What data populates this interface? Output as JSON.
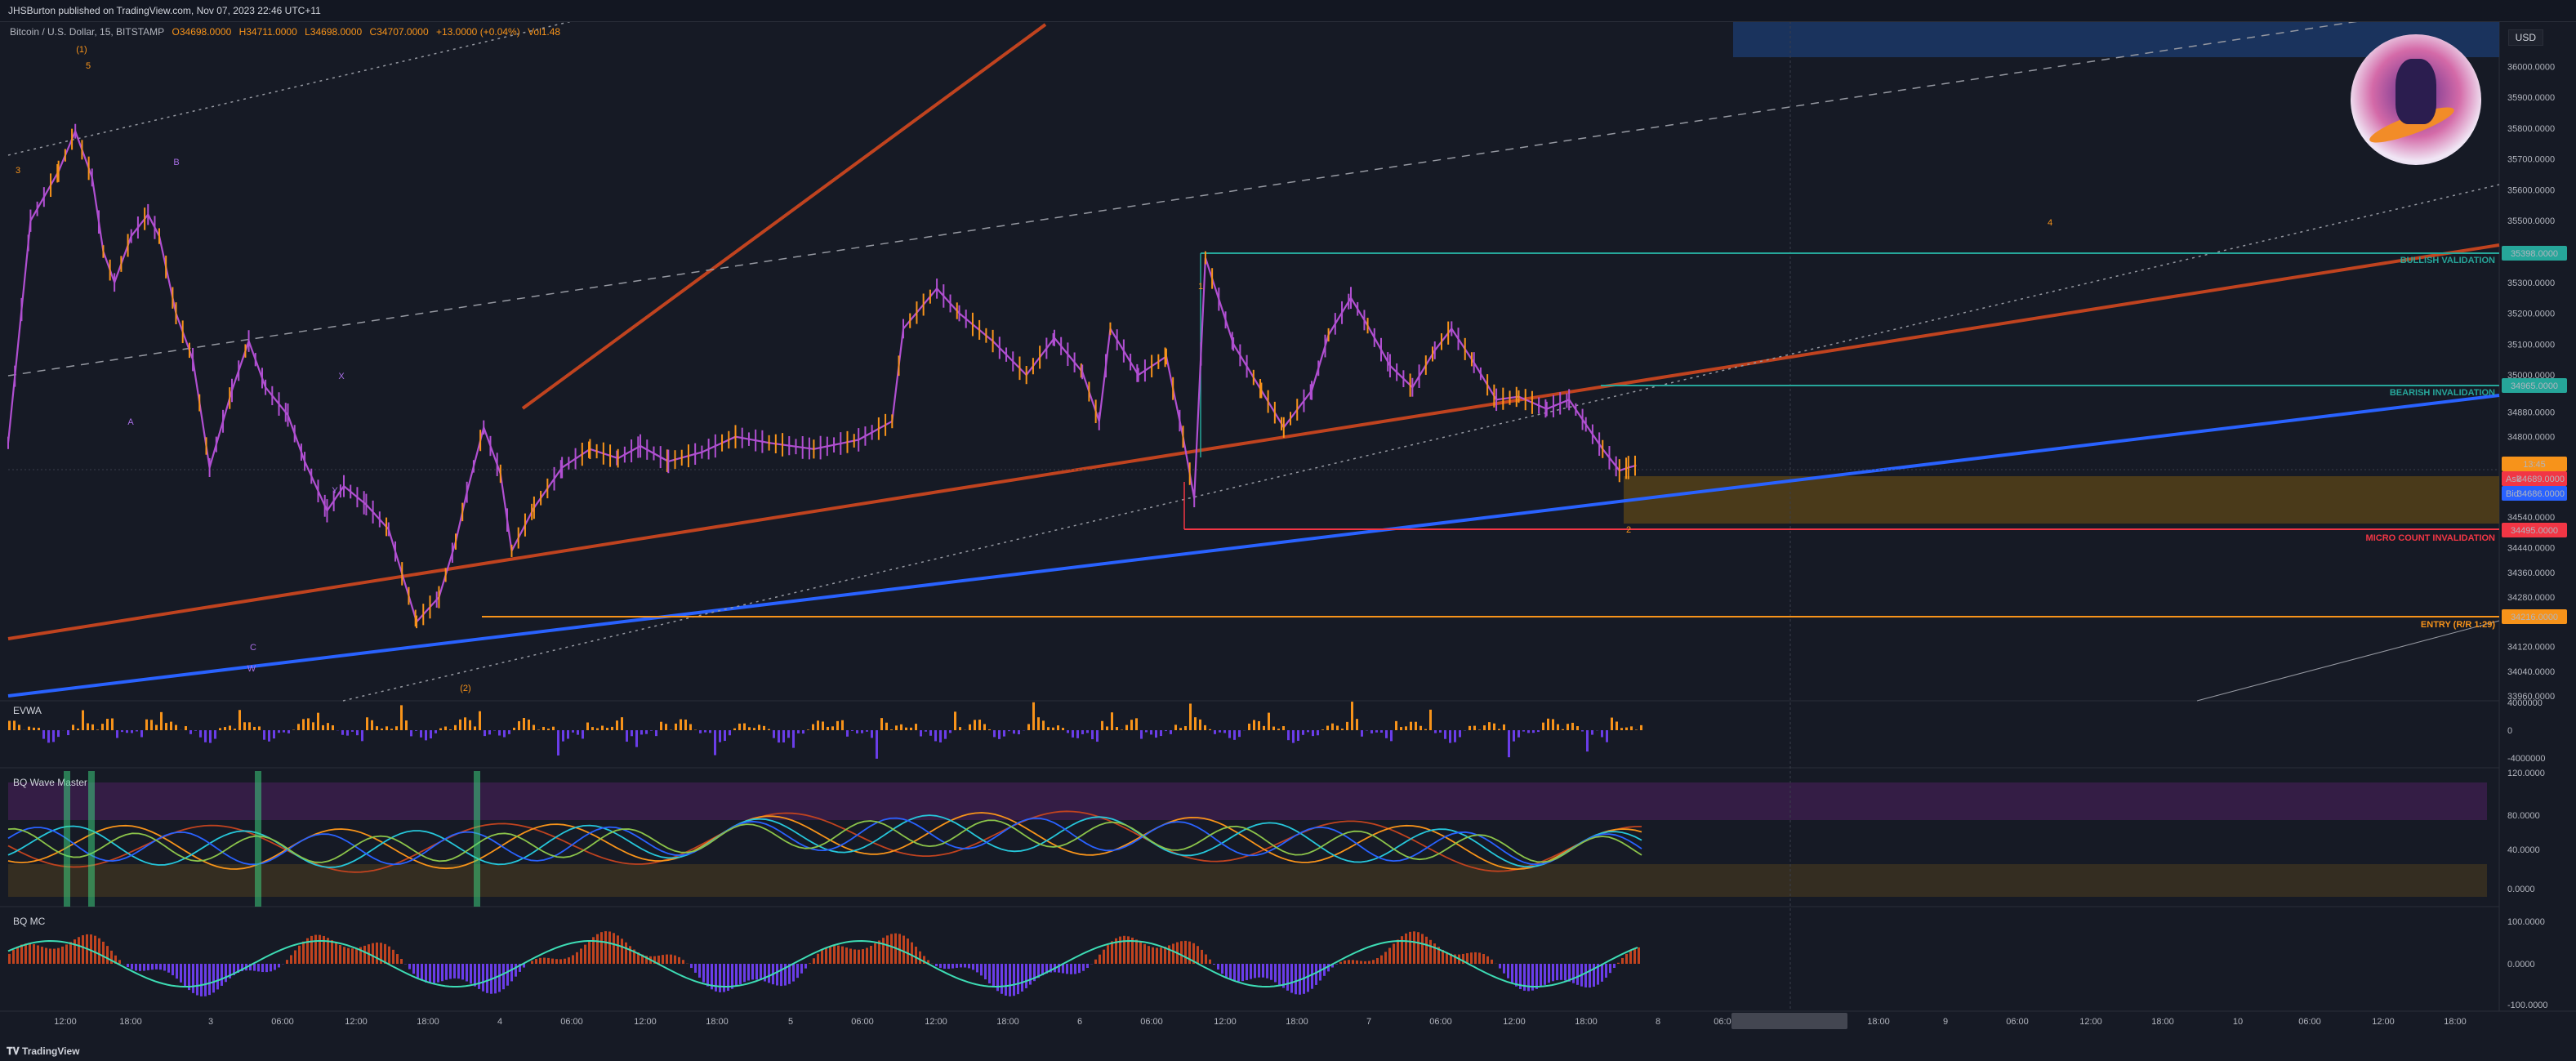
{
  "header": {
    "publisher": "JHSBurton published on TradingView.com, Nov 07, 2023 22:46 UTC+11"
  },
  "symbol": {
    "name": "Bitcoin / U.S. Dollar, 15, BITSTAMP",
    "open": "O34698.0000",
    "high": "H34711.0000",
    "low": "L34698.0000",
    "close": "C34707.0000",
    "change": "+13.0000 (+0.04%)",
    "vol": "Vol1.48"
  },
  "currency_button": "USD",
  "footer": {
    "brand": "TradingView"
  },
  "panes": {
    "evwa": "EVWA",
    "wave": "BQ Wave Master",
    "mc": "BQ MC"
  },
  "levels": [
    {
      "id": "bullish",
      "label": "BULLISH VALIDATION",
      "price_tag": "35398.0000",
      "color": "#26a69a"
    },
    {
      "id": "bearish",
      "label": "BEARISH INVALIDATION",
      "price_tag": "34965.0000",
      "color": "#26a69a"
    },
    {
      "id": "micro",
      "label": "MICRO COUNT INVALIDATION",
      "price_tag": "34495.0000",
      "color": "#f23645"
    },
    {
      "id": "entry",
      "label": "ENTRY (R/R 1:29)",
      "price_tag": "34216.0000",
      "color": "#f7931a"
    }
  ],
  "price_tags": {
    "last": "34707.0000",
    "ask_label": "Ask",
    "ask": "34689.0000",
    "bid_label": "Bid",
    "bid": "34686.0000",
    "countdown": "13:45"
  },
  "chart_data": {
    "type": "line",
    "title": "Bitcoin / U.S. Dollar, 15, BITSTAMP",
    "y_axis": {
      "range": [
        33960,
        36120
      ],
      "ticks": [
        "36000.0000",
        "35900.0000",
        "35800.0000",
        "35700.0000",
        "35600.0000",
        "35500.0000",
        "35300.0000",
        "35200.0000",
        "35100.0000",
        "35000.0000",
        "34880.0000",
        "34800.0000",
        "34540.0000",
        "34440.0000",
        "34360.0000",
        "34280.0000",
        "34120.0000",
        "34040.0000",
        "33960.0000"
      ]
    },
    "x_axis": {
      "ticks": [
        "12:00",
        "18:00",
        "3",
        "06:00",
        "12:00",
        "18:00",
        "4",
        "06:00",
        "12:00",
        "18:00",
        "5",
        "06:00",
        "12:00",
        "18:00",
        "6",
        "06:00",
        "12:00",
        "18:00",
        "7",
        "06:00",
        "12:00",
        "18:00",
        "8",
        "06:00",
        "Wed 08 Nov '23",
        "11:00",
        "18:00",
        "9",
        "06:00",
        "12:00",
        "18:00",
        "10",
        "06:00",
        "12:00",
        "18:00"
      ]
    },
    "price_series": {
      "name": "BTCUSD",
      "points": [
        [
          0,
          34780
        ],
        [
          20,
          35500
        ],
        [
          45,
          35660
        ],
        [
          60,
          35790
        ],
        [
          75,
          35640
        ],
        [
          85,
          35400
        ],
        [
          95,
          35300
        ],
        [
          110,
          35450
        ],
        [
          125,
          35520
        ],
        [
          135,
          35450
        ],
        [
          150,
          35200
        ],
        [
          165,
          35050
        ],
        [
          180,
          34700
        ],
        [
          200,
          34950
        ],
        [
          215,
          35110
        ],
        [
          230,
          34960
        ],
        [
          250,
          34870
        ],
        [
          265,
          34720
        ],
        [
          285,
          34560
        ],
        [
          300,
          34640
        ],
        [
          320,
          34580
        ],
        [
          340,
          34500
        ],
        [
          365,
          34200
        ],
        [
          385,
          34280
        ],
        [
          400,
          34460
        ],
        [
          410,
          34620
        ],
        [
          425,
          34830
        ],
        [
          440,
          34680
        ],
        [
          450,
          34430
        ],
        [
          470,
          34570
        ],
        [
          495,
          34700
        ],
        [
          520,
          34760
        ],
        [
          545,
          34730
        ],
        [
          565,
          34770
        ],
        [
          590,
          34720
        ],
        [
          620,
          34750
        ],
        [
          650,
          34800
        ],
        [
          680,
          34780
        ],
        [
          720,
          34760
        ],
        [
          760,
          34790
        ],
        [
          790,
          34850
        ],
        [
          800,
          35150
        ],
        [
          830,
          35280
        ],
        [
          850,
          35200
        ],
        [
          880,
          35110
        ],
        [
          910,
          35000
        ],
        [
          935,
          35120
        ],
        [
          960,
          35010
        ],
        [
          975,
          34850
        ],
        [
          985,
          35150
        ],
        [
          1010,
          35000
        ],
        [
          1035,
          35060
        ],
        [
          1050,
          34800
        ],
        [
          1060,
          34600
        ],
        [
          1070,
          35380
        ],
        [
          1095,
          35100
        ],
        [
          1120,
          34950
        ],
        [
          1140,
          34830
        ],
        [
          1165,
          34950
        ],
        [
          1180,
          35130
        ],
        [
          1200,
          35250
        ],
        [
          1215,
          35160
        ],
        [
          1235,
          35030
        ],
        [
          1255,
          34960
        ],
        [
          1275,
          35080
        ],
        [
          1290,
          35150
        ],
        [
          1310,
          35040
        ],
        [
          1330,
          34920
        ],
        [
          1350,
          34930
        ],
        [
          1375,
          34890
        ],
        [
          1395,
          34920
        ],
        [
          1410,
          34840
        ],
        [
          1425,
          34760
        ],
        [
          1440,
          34690
        ],
        [
          1448,
          34700
        ],
        [
          1455,
          34707
        ]
      ]
    },
    "wave_labels": [
      {
        "text": "(1)",
        "color": "#f7931a"
      },
      {
        "text": "(2)",
        "color": "#f7931a"
      },
      {
        "text": "5",
        "color": "#f7931a"
      },
      {
        "text": "3",
        "color": "#f7931a"
      },
      {
        "text": "B",
        "color": "#a86ee6"
      },
      {
        "text": "A",
        "color": "#a86ee6"
      },
      {
        "text": "C",
        "color": "#a86ee6"
      },
      {
        "text": "W",
        "color": "#a86ee6"
      },
      {
        "text": "X",
        "color": "#a86ee6"
      },
      {
        "text": "Y",
        "color": "#a86ee6"
      },
      {
        "text": "1",
        "color": "#f7931a"
      },
      {
        "text": "2",
        "color": "#f7931a"
      },
      {
        "text": "4",
        "color": "#f7931a"
      }
    ],
    "evwa_axis": [
      "4000000",
      "0",
      "-4000000"
    ],
    "wave_axis": [
      "120.0000",
      "80.0000",
      "40.0000",
      "0.0000"
    ],
    "mc_axis": [
      "100.0000",
      "0.0000",
      "-100.0000"
    ]
  }
}
